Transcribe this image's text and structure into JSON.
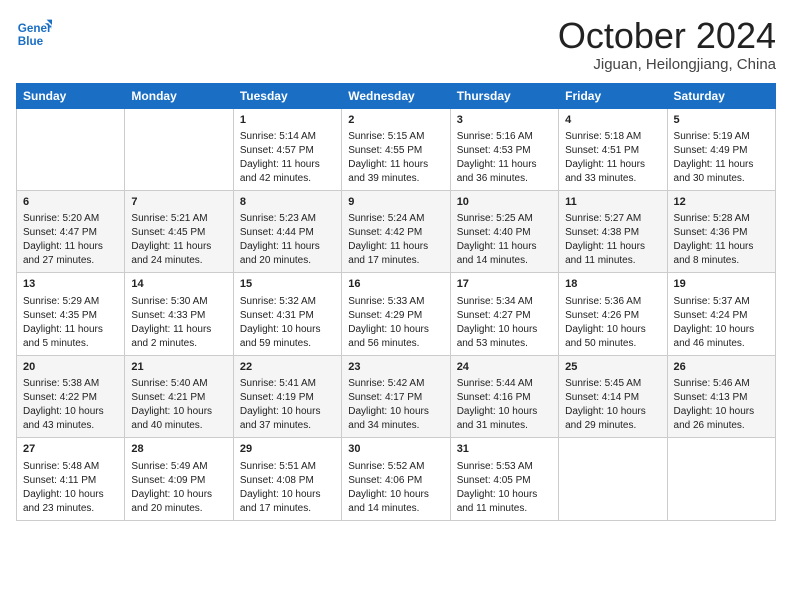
{
  "logo": {
    "line1": "General",
    "line2": "Blue"
  },
  "title": "October 2024",
  "location": "Jiguan, Heilongjiang, China",
  "days_of_week": [
    "Sunday",
    "Monday",
    "Tuesday",
    "Wednesday",
    "Thursday",
    "Friday",
    "Saturday"
  ],
  "weeks": [
    [
      {
        "day": "",
        "sunrise": "",
        "sunset": "",
        "daylight": ""
      },
      {
        "day": "",
        "sunrise": "",
        "sunset": "",
        "daylight": ""
      },
      {
        "day": "1",
        "sunrise": "Sunrise: 5:14 AM",
        "sunset": "Sunset: 4:57 PM",
        "daylight": "Daylight: 11 hours and 42 minutes."
      },
      {
        "day": "2",
        "sunrise": "Sunrise: 5:15 AM",
        "sunset": "Sunset: 4:55 PM",
        "daylight": "Daylight: 11 hours and 39 minutes."
      },
      {
        "day": "3",
        "sunrise": "Sunrise: 5:16 AM",
        "sunset": "Sunset: 4:53 PM",
        "daylight": "Daylight: 11 hours and 36 minutes."
      },
      {
        "day": "4",
        "sunrise": "Sunrise: 5:18 AM",
        "sunset": "Sunset: 4:51 PM",
        "daylight": "Daylight: 11 hours and 33 minutes."
      },
      {
        "day": "5",
        "sunrise": "Sunrise: 5:19 AM",
        "sunset": "Sunset: 4:49 PM",
        "daylight": "Daylight: 11 hours and 30 minutes."
      }
    ],
    [
      {
        "day": "6",
        "sunrise": "Sunrise: 5:20 AM",
        "sunset": "Sunset: 4:47 PM",
        "daylight": "Daylight: 11 hours and 27 minutes."
      },
      {
        "day": "7",
        "sunrise": "Sunrise: 5:21 AM",
        "sunset": "Sunset: 4:45 PM",
        "daylight": "Daylight: 11 hours and 24 minutes."
      },
      {
        "day": "8",
        "sunrise": "Sunrise: 5:23 AM",
        "sunset": "Sunset: 4:44 PM",
        "daylight": "Daylight: 11 hours and 20 minutes."
      },
      {
        "day": "9",
        "sunrise": "Sunrise: 5:24 AM",
        "sunset": "Sunset: 4:42 PM",
        "daylight": "Daylight: 11 hours and 17 minutes."
      },
      {
        "day": "10",
        "sunrise": "Sunrise: 5:25 AM",
        "sunset": "Sunset: 4:40 PM",
        "daylight": "Daylight: 11 hours and 14 minutes."
      },
      {
        "day": "11",
        "sunrise": "Sunrise: 5:27 AM",
        "sunset": "Sunset: 4:38 PM",
        "daylight": "Daylight: 11 hours and 11 minutes."
      },
      {
        "day": "12",
        "sunrise": "Sunrise: 5:28 AM",
        "sunset": "Sunset: 4:36 PM",
        "daylight": "Daylight: 11 hours and 8 minutes."
      }
    ],
    [
      {
        "day": "13",
        "sunrise": "Sunrise: 5:29 AM",
        "sunset": "Sunset: 4:35 PM",
        "daylight": "Daylight: 11 hours and 5 minutes."
      },
      {
        "day": "14",
        "sunrise": "Sunrise: 5:30 AM",
        "sunset": "Sunset: 4:33 PM",
        "daylight": "Daylight: 11 hours and 2 minutes."
      },
      {
        "day": "15",
        "sunrise": "Sunrise: 5:32 AM",
        "sunset": "Sunset: 4:31 PM",
        "daylight": "Daylight: 10 hours and 59 minutes."
      },
      {
        "day": "16",
        "sunrise": "Sunrise: 5:33 AM",
        "sunset": "Sunset: 4:29 PM",
        "daylight": "Daylight: 10 hours and 56 minutes."
      },
      {
        "day": "17",
        "sunrise": "Sunrise: 5:34 AM",
        "sunset": "Sunset: 4:27 PM",
        "daylight": "Daylight: 10 hours and 53 minutes."
      },
      {
        "day": "18",
        "sunrise": "Sunrise: 5:36 AM",
        "sunset": "Sunset: 4:26 PM",
        "daylight": "Daylight: 10 hours and 50 minutes."
      },
      {
        "day": "19",
        "sunrise": "Sunrise: 5:37 AM",
        "sunset": "Sunset: 4:24 PM",
        "daylight": "Daylight: 10 hours and 46 minutes."
      }
    ],
    [
      {
        "day": "20",
        "sunrise": "Sunrise: 5:38 AM",
        "sunset": "Sunset: 4:22 PM",
        "daylight": "Daylight: 10 hours and 43 minutes."
      },
      {
        "day": "21",
        "sunrise": "Sunrise: 5:40 AM",
        "sunset": "Sunset: 4:21 PM",
        "daylight": "Daylight: 10 hours and 40 minutes."
      },
      {
        "day": "22",
        "sunrise": "Sunrise: 5:41 AM",
        "sunset": "Sunset: 4:19 PM",
        "daylight": "Daylight: 10 hours and 37 minutes."
      },
      {
        "day": "23",
        "sunrise": "Sunrise: 5:42 AM",
        "sunset": "Sunset: 4:17 PM",
        "daylight": "Daylight: 10 hours and 34 minutes."
      },
      {
        "day": "24",
        "sunrise": "Sunrise: 5:44 AM",
        "sunset": "Sunset: 4:16 PM",
        "daylight": "Daylight: 10 hours and 31 minutes."
      },
      {
        "day": "25",
        "sunrise": "Sunrise: 5:45 AM",
        "sunset": "Sunset: 4:14 PM",
        "daylight": "Daylight: 10 hours and 29 minutes."
      },
      {
        "day": "26",
        "sunrise": "Sunrise: 5:46 AM",
        "sunset": "Sunset: 4:13 PM",
        "daylight": "Daylight: 10 hours and 26 minutes."
      }
    ],
    [
      {
        "day": "27",
        "sunrise": "Sunrise: 5:48 AM",
        "sunset": "Sunset: 4:11 PM",
        "daylight": "Daylight: 10 hours and 23 minutes."
      },
      {
        "day": "28",
        "sunrise": "Sunrise: 5:49 AM",
        "sunset": "Sunset: 4:09 PM",
        "daylight": "Daylight: 10 hours and 20 minutes."
      },
      {
        "day": "29",
        "sunrise": "Sunrise: 5:51 AM",
        "sunset": "Sunset: 4:08 PM",
        "daylight": "Daylight: 10 hours and 17 minutes."
      },
      {
        "day": "30",
        "sunrise": "Sunrise: 5:52 AM",
        "sunset": "Sunset: 4:06 PM",
        "daylight": "Daylight: 10 hours and 14 minutes."
      },
      {
        "day": "31",
        "sunrise": "Sunrise: 5:53 AM",
        "sunset": "Sunset: 4:05 PM",
        "daylight": "Daylight: 10 hours and 11 minutes."
      },
      {
        "day": "",
        "sunrise": "",
        "sunset": "",
        "daylight": ""
      },
      {
        "day": "",
        "sunrise": "",
        "sunset": "",
        "daylight": ""
      }
    ]
  ]
}
